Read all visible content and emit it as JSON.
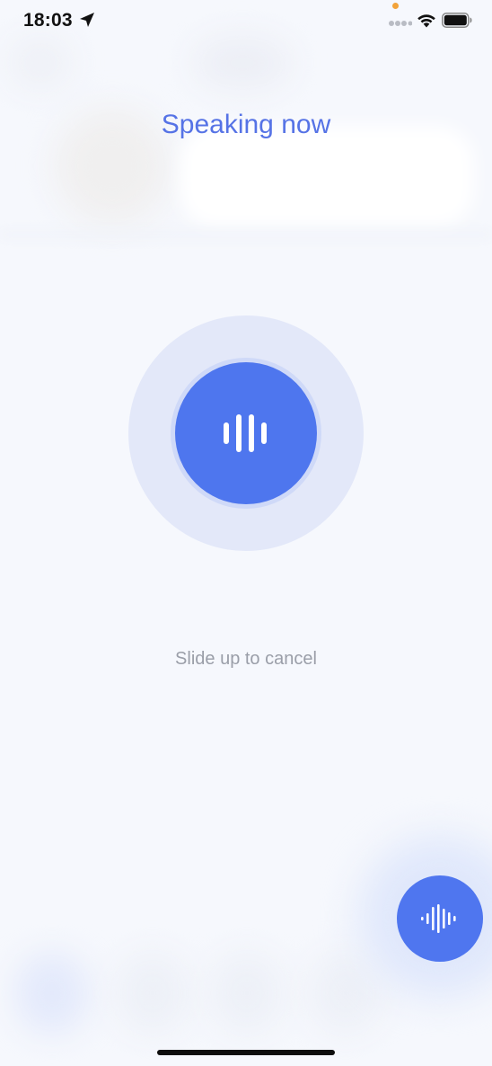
{
  "status_bar": {
    "time": "18:03",
    "icons": [
      "location-arrow-icon",
      "cellular-signal-icon",
      "wifi-icon",
      "battery-icon"
    ]
  },
  "voice": {
    "title": "Speaking now",
    "hint": "Slide up to cancel"
  },
  "icons": {
    "mic_button": "audio-bars-icon",
    "fab": "waveform-icon"
  },
  "colors": {
    "accent": "#4e76ee",
    "title": "#5673e6",
    "hint": "#9a9ea8",
    "halo_outer": "#e3e8f9",
    "halo_inner": "#cfd9f8",
    "background": "#f6f8fd"
  }
}
